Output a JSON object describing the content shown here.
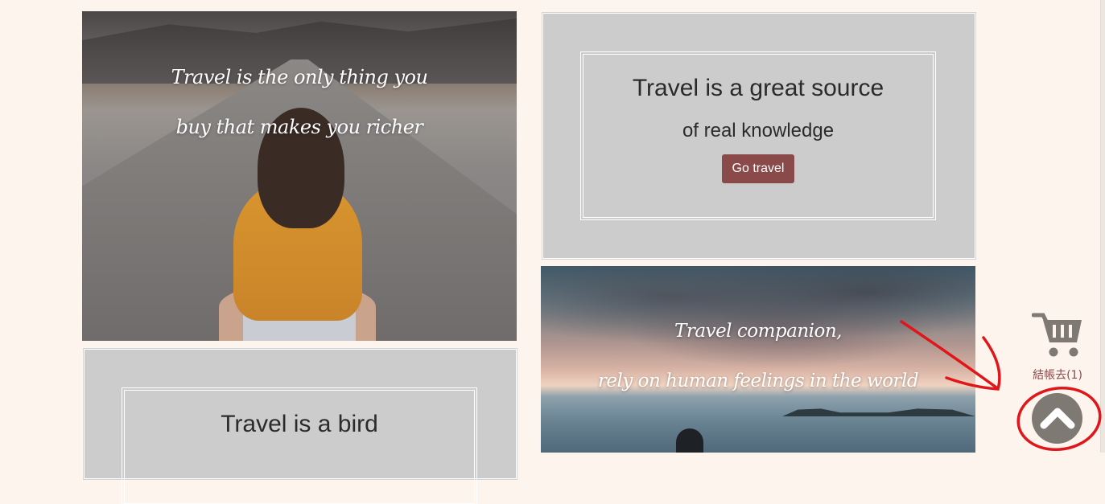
{
  "gallery": {
    "road_photo": {
      "quote_line1": "Travel is the only thing you",
      "quote_line2": "buy that makes you richer"
    },
    "card_knowledge": {
      "title": "Travel is a great source",
      "subtitle": "of real knowledge",
      "button_label": "Go travel"
    },
    "beach_photo": {
      "quote_line1": "Travel companion,",
      "quote_line2": "rely on human feelings in the world"
    },
    "card_bird": {
      "title": "Travel is a bird"
    }
  },
  "cart": {
    "icon": "shopping-cart-icon",
    "label": "結帳去(1)",
    "color": "#8a4a4a"
  },
  "back_to_top": {
    "icon": "chevron-up-icon",
    "color": "#7f7974"
  },
  "annotation": {
    "color": "#e0161a"
  }
}
